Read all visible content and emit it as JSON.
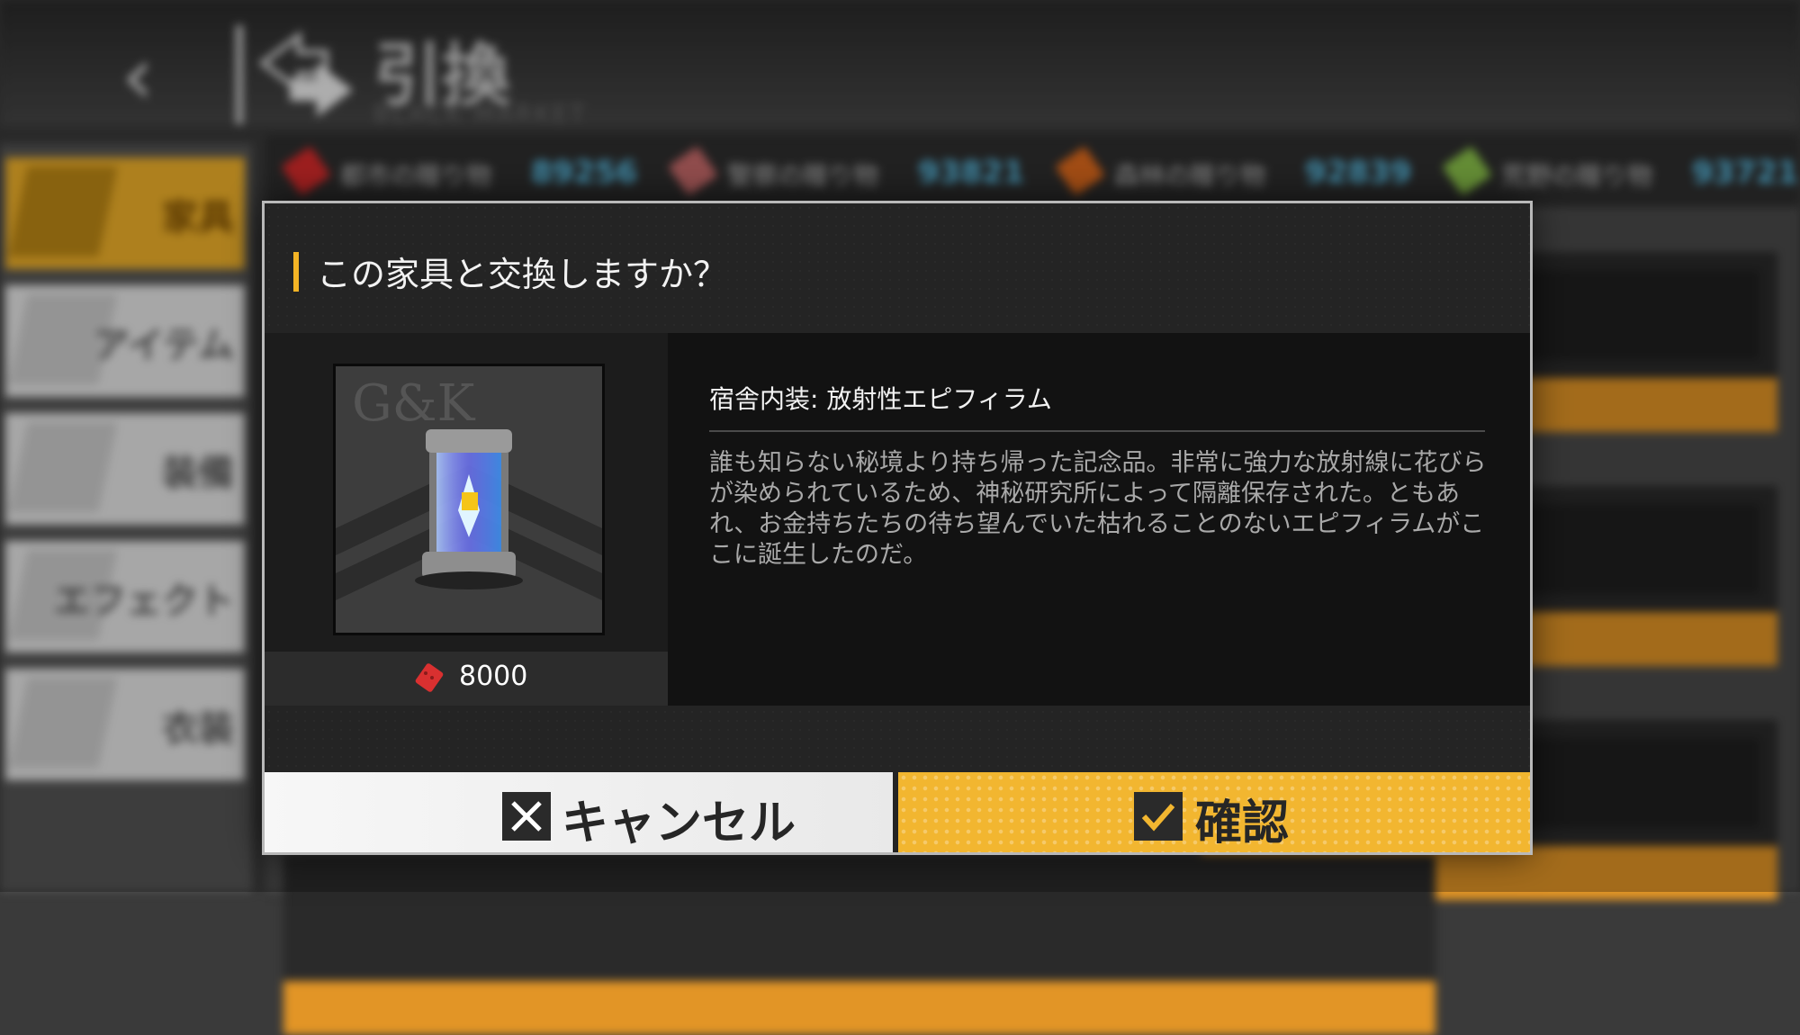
{
  "header": {
    "back_label": "‹",
    "title": "引換",
    "subtitle": "BLACK MARKET"
  },
  "sidebar": {
    "items": [
      {
        "label": "家具",
        "active": true
      },
      {
        "label": "アイテム",
        "active": false
      },
      {
        "label": "装備",
        "active": false
      },
      {
        "label": "エフェクト",
        "active": false
      },
      {
        "label": "衣装",
        "active": false
      }
    ]
  },
  "currencies": [
    {
      "name": "都市の贈り物",
      "value": "89256",
      "color": "#d92b2b"
    },
    {
      "name": "警察の贈り物",
      "value": "93821",
      "color": "#c86a6a"
    },
    {
      "name": "森林の贈り物",
      "value": "92839",
      "color": "#e06a1c"
    },
    {
      "name": "荒野の贈り物",
      "value": "93721",
      "color": "#8bc34a"
    }
  ],
  "dialog": {
    "title": "この家具と交換しますか？",
    "item_name": "宿舎内装: 放射性エピフィラム",
    "item_desc": "誰も知らない秘境より持ち帰った記念品。非常に強力な放射線に花びらが染められているため、神秘研究所によって隔離保存された。ともあれ、お金持ちたちの待ち望んでいた枯れることのないエピフィラムがここに誕生したのだ。",
    "price": "8000",
    "price_icon": "red-brick-icon",
    "cancel_label": "キャンセル",
    "confirm_label": "確認",
    "accent_color": "#f4b425"
  }
}
